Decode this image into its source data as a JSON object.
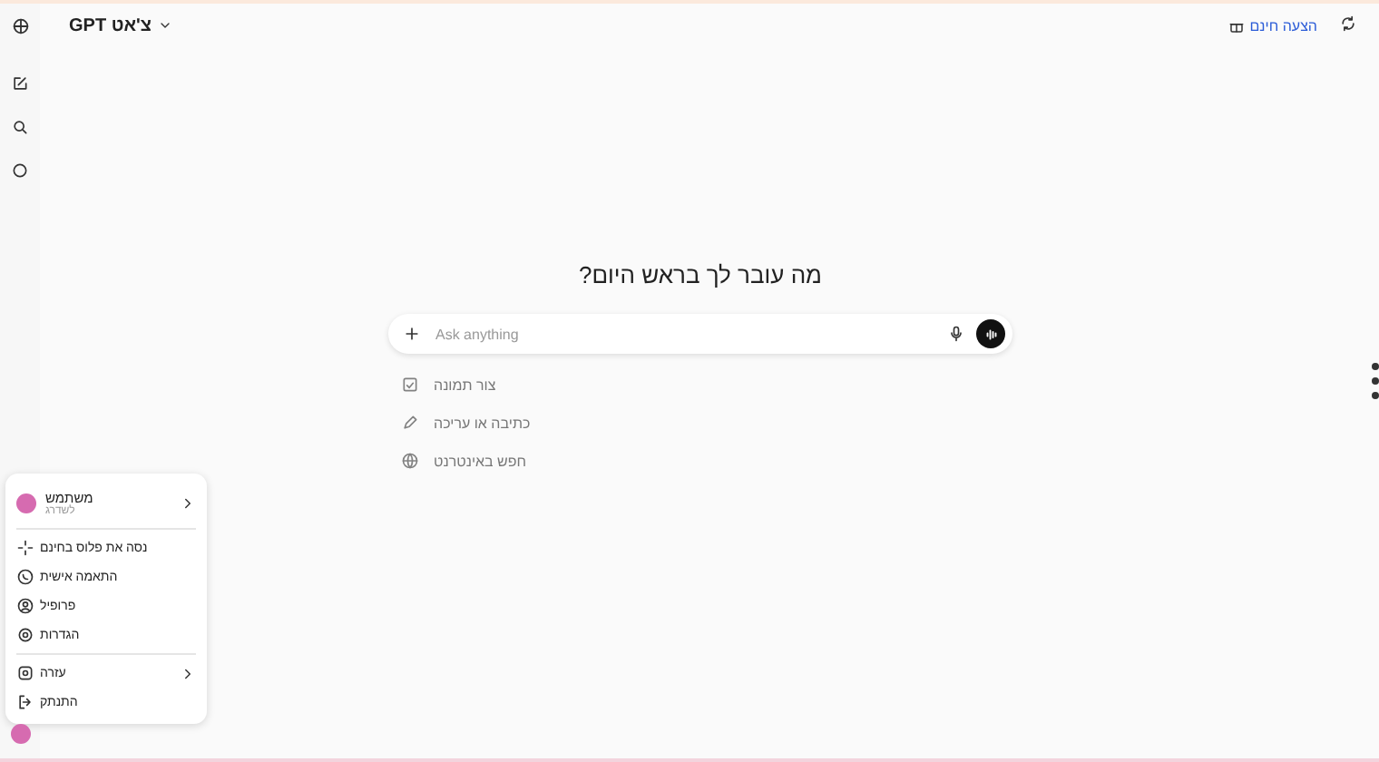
{
  "top_bar": {
    "model_title": "צ'אט GPT",
    "offer_link": "הצעה חינם"
  },
  "heading": "מה עובר לך בראש היום?",
  "composer": {
    "placeholder": "Ask anything"
  },
  "suggestions": [
    "צור תמונה",
    "כתיבה או עריכה",
    "חפש באינטרנט"
  ],
  "account_menu": {
    "user": {
      "name": "משתמש",
      "subtitle": "לשדרג",
      "submenu": true
    },
    "groups": [
      [
        {
          "label": "נסה את פלוס בחינם",
          "submenu": false
        },
        {
          "label": "התאמה אישית",
          "submenu": false
        },
        {
          "label": "פרופיל",
          "submenu": false
        },
        {
          "label": "הגדרות",
          "submenu": false
        }
      ],
      [
        {
          "label": "עזרה",
          "submenu": true
        },
        {
          "label": "התנתק",
          "submenu": false
        }
      ]
    ]
  }
}
